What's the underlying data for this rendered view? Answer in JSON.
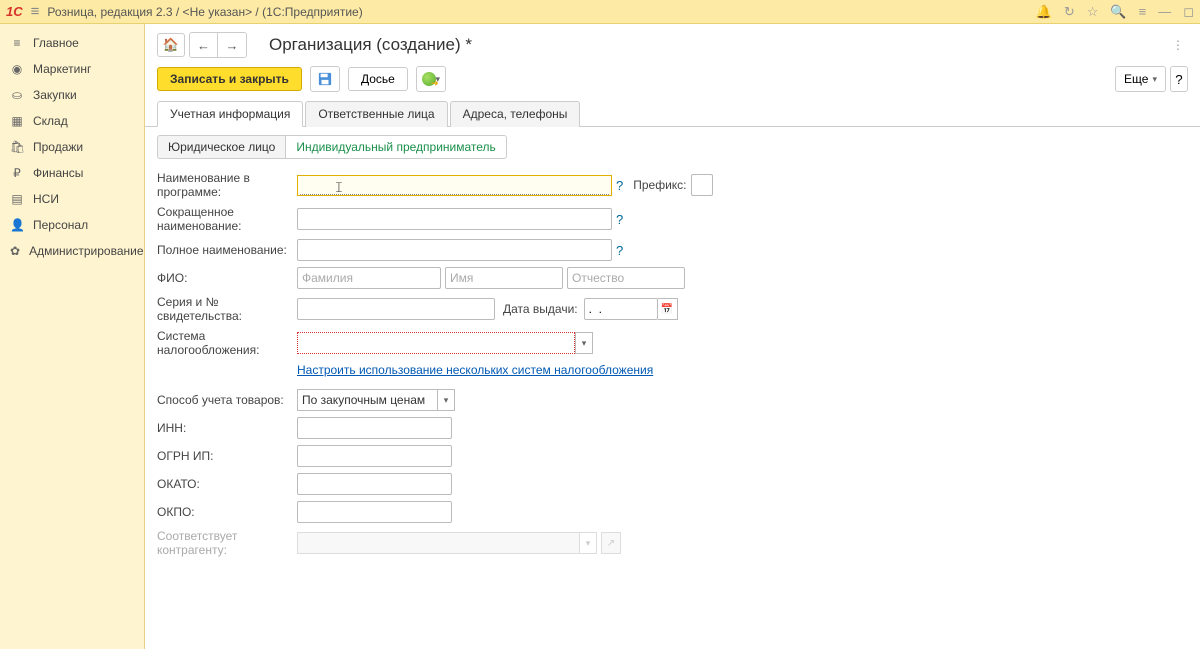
{
  "titlebar": {
    "logo": "1C",
    "title": "Розница, редакция 2.3 / <Не указан> /  (1С:Предприятие)"
  },
  "sidebar": {
    "items": [
      {
        "icon": "≡",
        "label": "Главное"
      },
      {
        "icon": "◉",
        "label": "Маркетинг"
      },
      {
        "icon": "⛀",
        "label": "Закупки"
      },
      {
        "icon": "▦",
        "label": "Склад"
      },
      {
        "icon": "🛍",
        "label": "Продажи"
      },
      {
        "icon": "₽",
        "label": "Финансы"
      },
      {
        "icon": "▤",
        "label": "НСИ"
      },
      {
        "icon": "👤",
        "label": "Персонал"
      },
      {
        "icon": "✿",
        "label": "Администрирование"
      }
    ]
  },
  "header": {
    "title": "Организация (создание) *"
  },
  "toolbar": {
    "save_close": "Записать и закрыть",
    "dossier": "Досье",
    "more": "Еще"
  },
  "tabs": {
    "items": [
      "Учетная информация",
      "Ответственные лица",
      "Адреса, телефоны"
    ],
    "active": 0
  },
  "subtabs": {
    "items": [
      "Юридическое лицо",
      "Индивидуальный предприниматель"
    ],
    "active": 1
  },
  "form": {
    "name_label": "Наименование в программе:",
    "prefix_label": "Префикс:",
    "short_name_label": "Сокращенное наименование:",
    "full_name_label": "Полное наименование:",
    "fio_label": "ФИО:",
    "fio_placeholders": {
      "f": "Фамилия",
      "i": "Имя",
      "o": "Отчество"
    },
    "cert_label": "Серия и № свидетельства:",
    "issue_date_label": "Дата выдачи:",
    "issue_date_value": ".  .",
    "tax_label": "Система налогообложения:",
    "tax_link": "Настроить использование нескольких систем налогообложения",
    "goods_label": "Способ учета товаров:",
    "goods_value": "По закупочным ценам",
    "inn_label": "ИНН:",
    "ogrn_label": "ОГРН ИП:",
    "okato_label": "ОКАТО:",
    "okpo_label": "ОКПО:",
    "counterparty_label": "Соответствует контрагенту:"
  }
}
